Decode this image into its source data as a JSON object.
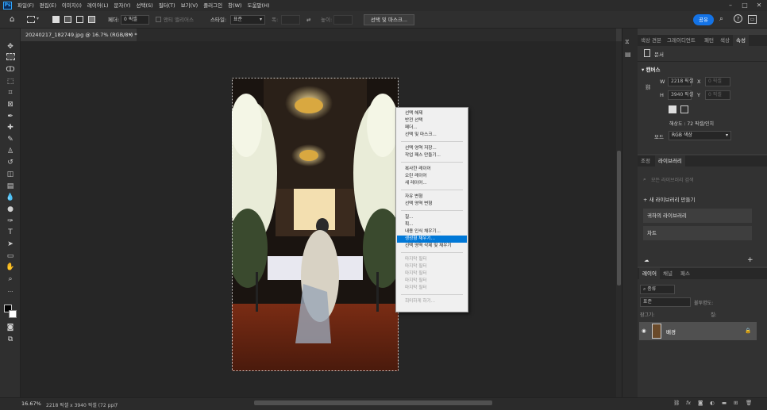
{
  "app": {
    "logo": "Ps"
  },
  "menu": [
    "파일(F)",
    "편집(E)",
    "이미지(I)",
    "레이어(L)",
    "문자(Y)",
    "선택(S)",
    "필터(T)",
    "보기(V)",
    "플러그인",
    "창(W)",
    "도움말(H)"
  ],
  "options": {
    "feather_label": "페더:",
    "feather_value": "0 픽셀",
    "antialias_label": "앤티 앨리어스",
    "style_label": "스타일:",
    "style_value": "표준",
    "width_label": "폭:",
    "height_label": "높이:",
    "select_mask_button": "선택 및 마스크...",
    "share_button": "공유"
  },
  "document": {
    "tab_title": "20240217_182749.jpg @ 16.7% (RGB/8*) *",
    "zoom": "16.67%",
    "info": "2218 픽셀 x 3940 픽셀 (72 ppi)"
  },
  "context_menu": {
    "items": [
      {
        "label": "선택 해제",
        "disabled": false
      },
      {
        "label": "반전 선택",
        "disabled": false
      },
      {
        "label": "페더...",
        "disabled": false
      },
      {
        "label": "선택 및 마스크...",
        "disabled": false
      },
      {
        "label": "선택 영역 저장...",
        "disabled": false
      },
      {
        "label": "작업 패스 만들기...",
        "disabled": false
      },
      {
        "label": "복사한 레이어",
        "disabled": false
      },
      {
        "label": "오린 레이어",
        "disabled": false
      },
      {
        "label": "새 레이어...",
        "disabled": false
      },
      {
        "label": "자유 변형",
        "disabled": false
      },
      {
        "label": "선택 영역 변형",
        "disabled": false
      },
      {
        "label": "칠...",
        "disabled": false
      },
      {
        "label": "획...",
        "disabled": false
      },
      {
        "label": "내용 인식 채우기...",
        "disabled": false
      },
      {
        "label": "생성형 채우기...",
        "disabled": false,
        "highlighted": true
      },
      {
        "label": "선택 영역 삭제 및 채우기",
        "disabled": false
      },
      {
        "label": "마지막 필터",
        "disabled": true
      },
      {
        "label": "마지막 필터",
        "disabled": true
      },
      {
        "label": "마지막 필터",
        "disabled": true
      },
      {
        "label": "마지막 필터",
        "disabled": true
      },
      {
        "label": "마지막 필터",
        "disabled": true
      },
      {
        "label": "희미하게 하기...",
        "disabled": true
      }
    ]
  },
  "properties_panel": {
    "tabs": [
      "색상 견본",
      "그레이디언트",
      "패턴",
      "색상",
      "속성"
    ],
    "doc_label": "문서",
    "canvas_section": "캔버스",
    "w_label": "W",
    "w_value": "2218 픽셀",
    "h_label": "H",
    "h_value": "3940 픽셀",
    "x_label": "X",
    "x_placeholder": "0 픽셀",
    "y_label": "Y",
    "y_placeholder": "0 픽셀",
    "resolution": "해상도 : 72 픽셀/인치",
    "mode_label": "모드",
    "mode_value": "RGB 색상"
  },
  "library_panel": {
    "tabs": [
      "조정",
      "라이브러리"
    ],
    "search_placeholder": "모든 라이브러리 검색",
    "create_button": "새 라이브러리 만들기",
    "items": [
      "귀하의 라이브러리",
      "차트"
    ]
  },
  "layers_panel": {
    "tabs": [
      "레이어",
      "채널",
      "패스"
    ],
    "filter_label": "종류",
    "blend_mode": "표준",
    "opacity_label": "불투명도:",
    "lock_label": "잠그기:",
    "fill_label": "칠:",
    "layer_name": "배경"
  },
  "colors": {
    "accent": "#1473e6",
    "highlight": "#0078d7"
  }
}
